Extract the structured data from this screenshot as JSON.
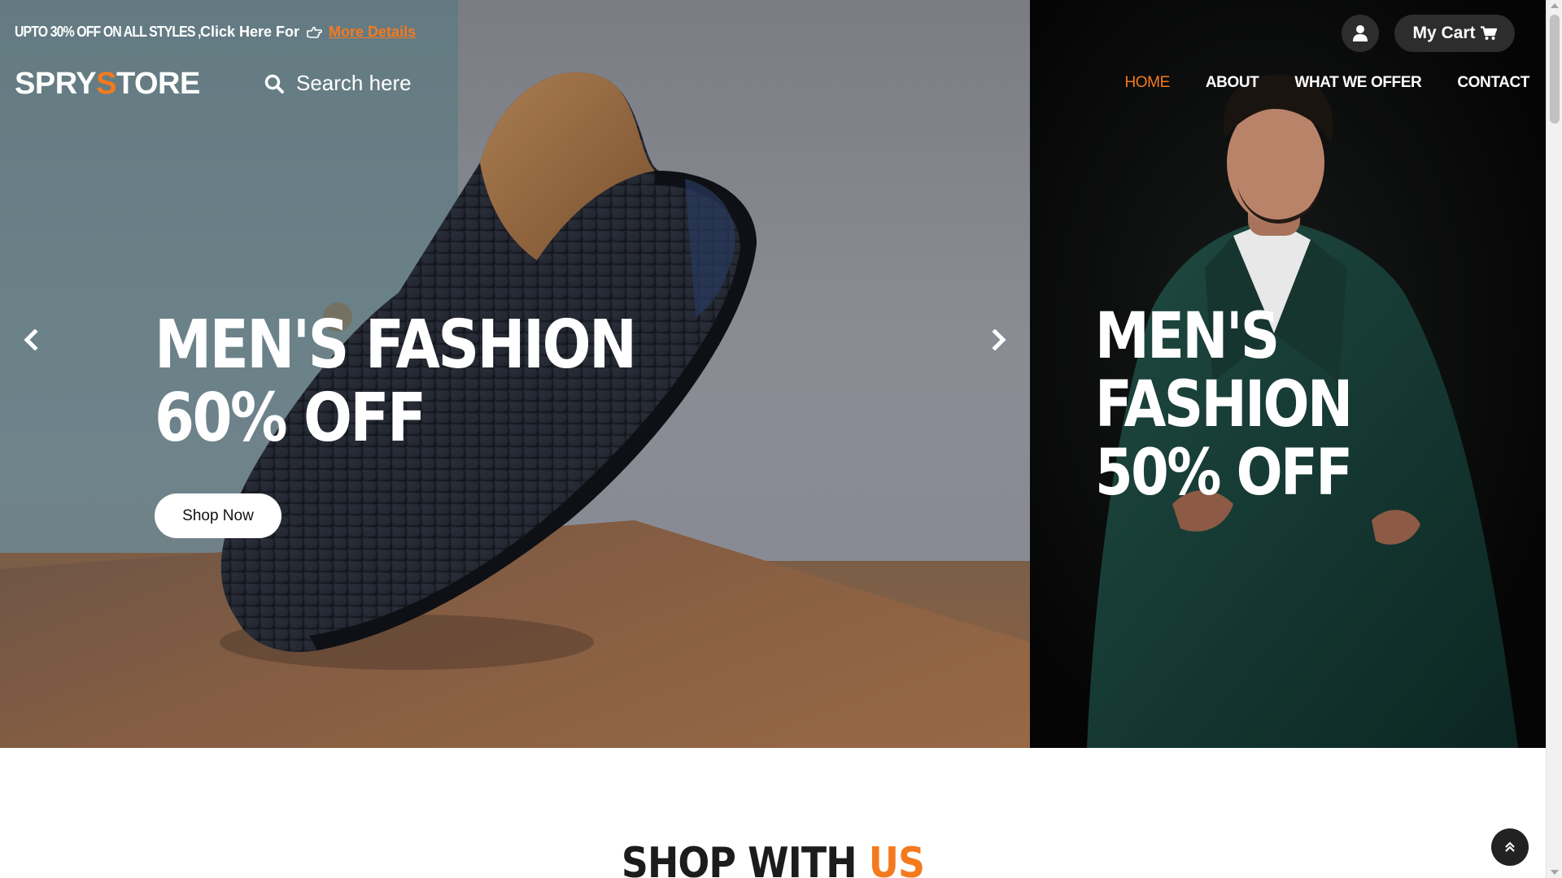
{
  "topbar": {
    "promo_text": "UPTO 30% OFF ON ALL STYLES ,",
    "promo_click": "Click Here For",
    "promo_link": "More Details"
  },
  "logo": {
    "part1": "SPRY",
    "accent": "S",
    "part2": "TORE"
  },
  "search": {
    "placeholder": "Search here"
  },
  "header": {
    "cart_label": "My Cart"
  },
  "nav": {
    "items": [
      {
        "label": "HOME"
      },
      {
        "label": "ABOUT"
      },
      {
        "label": "WHAT WE OFFER"
      },
      {
        "label": "CONTACT"
      }
    ]
  },
  "slides": [
    {
      "line1": "MEN'S FASHION",
      "line2": "60% OFF",
      "button": "Shop Now"
    },
    {
      "line1": "MEN'S FASHION",
      "line2": "50% OFF"
    }
  ],
  "section": {
    "title": "SHOP WITH",
    "accent": "US"
  },
  "colors": {
    "accent": "#f47a1f",
    "dark_button": "#2d2d2d"
  },
  "icons": [
    "hand-point-right-icon",
    "search-icon",
    "user-icon",
    "cart-icon",
    "chevron-left-icon",
    "chevron-right-icon",
    "double-chevron-up-icon"
  ]
}
